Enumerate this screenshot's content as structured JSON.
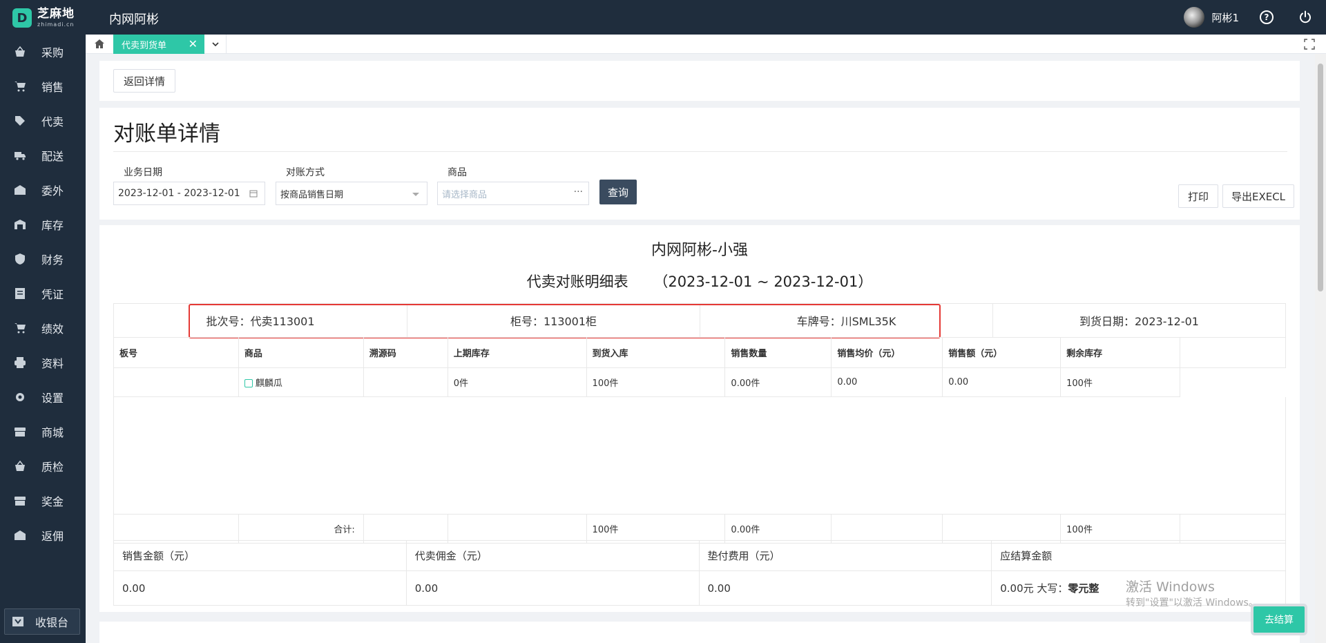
{
  "app": {
    "logo_cn": "芝麻地",
    "logo_en": "zhimadi.cn",
    "title": "内网阿彬"
  },
  "user": {
    "name": "阿彬1"
  },
  "sidebar": {
    "items": [
      {
        "label": "采购",
        "icon": "basket-icon"
      },
      {
        "label": "销售",
        "icon": "cart-icon"
      },
      {
        "label": "代卖",
        "icon": "tag-icon"
      },
      {
        "label": "配送",
        "icon": "truck-icon"
      },
      {
        "label": "委外",
        "icon": "store-icon"
      },
      {
        "label": "库存",
        "icon": "warehouse-icon"
      },
      {
        "label": "财务",
        "icon": "money-icon"
      },
      {
        "label": "凭证",
        "icon": "voucher-icon"
      },
      {
        "label": "绩效",
        "icon": "cart-icon"
      },
      {
        "label": "资料",
        "icon": "printer-icon"
      },
      {
        "label": "设置",
        "icon": "gear-icon"
      },
      {
        "label": "商城",
        "icon": "shop-icon"
      },
      {
        "label": "质检",
        "icon": "basket-icon"
      },
      {
        "label": "奖金",
        "icon": "shop-icon"
      },
      {
        "label": "返佣",
        "icon": "store-icon"
      }
    ],
    "cashier": "收银台"
  },
  "tabs": {
    "active": "代卖到货单"
  },
  "toolbar": {
    "back": "返回详情"
  },
  "page": {
    "title": "对账单详情"
  },
  "filters": {
    "date_label": "业务日期",
    "date_value": "2023-12-01 - 2023-12-01",
    "mode_label": "对账方式",
    "mode_value": "按商品销售日期",
    "goods_label": "商品",
    "goods_placeholder": "请选择商品",
    "query": "查询",
    "print": "打印",
    "export": "导出EXECL"
  },
  "report": {
    "company": "内网阿彬-小强",
    "title": "代卖对账明细表",
    "period": "（2023-12-01 ~ 2023-12-01）",
    "batch": "批次号：代卖113001",
    "cabinet": "柜号：113001柜",
    "plate": "车牌号：川SML35K",
    "arrival": "到货日期：2023-12-01",
    "columns": [
      "板号",
      "商品",
      "溯源码",
      "上期库存",
      "到货入库",
      "销售数量",
      "销售均价（元）",
      "销售额（元）",
      "剩余库存"
    ],
    "rows": [
      [
        "",
        "麒麟瓜",
        "",
        "0件",
        "100件",
        "0.00件",
        "0.00",
        "0.00",
        "100件"
      ]
    ],
    "total_label": "合计:",
    "totals": {
      "arrival": "100件",
      "sold": "0.00件",
      "remain": "100件"
    },
    "summary_headers": [
      "销售金额（元）",
      "代卖佣金（元）",
      "垫付费用（元）",
      "应结算金额"
    ],
    "summary_values": [
      "0.00",
      "0.00",
      "0.00"
    ],
    "settle_amount": "0.00元 大写：",
    "settle_upper": "零元整"
  },
  "watermark": {
    "line1": "激活 Windows",
    "line2": "转到\"设置\"以激活 Windows。"
  },
  "settle_button": "去结算",
  "colors": {
    "accent": "#2ec7a7",
    "nav": "#1f2d3d",
    "highlight": "#e53935"
  }
}
